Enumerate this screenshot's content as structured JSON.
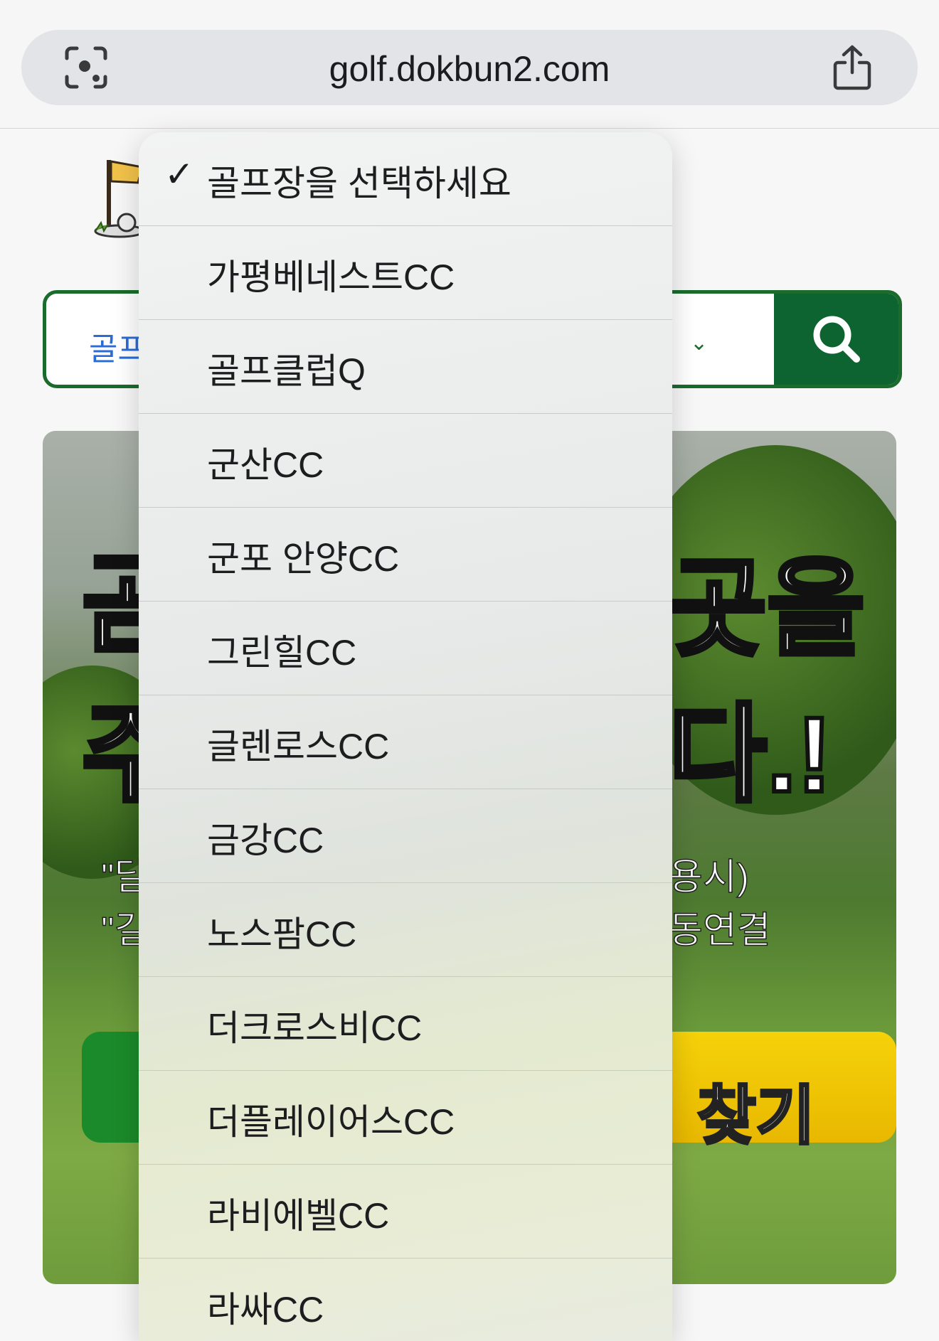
{
  "browser": {
    "url": "golf.dokbun2.com",
    "left_icon": "visual-lookup-icon",
    "right_icon": "share-icon"
  },
  "search": {
    "selected_partial": "골프",
    "chevron_icon": "chevron-down-icon",
    "button_icon": "search-icon"
  },
  "banner": {
    "text_fragments": [
      "곳을",
      "다.!",
      "용시)",
      "동연결",
      "찾기"
    ],
    "quote_marks": [
      "\"달",
      "\"길"
    ]
  },
  "dropdown": {
    "selected_index": 0,
    "options": [
      "골프장을 선택하세요",
      "가평베네스트CC",
      "골프클럽Q",
      "군산CC",
      "군포 안양CC",
      "그린힐CC",
      "글렌로스CC",
      "금강CC",
      "노스팜CC",
      "더크로스비CC",
      "더플레이어스CC",
      "라비에벨CC",
      "라싸CC"
    ],
    "check_glyph": "✓"
  },
  "colors": {
    "brand_green": "#0e6430",
    "select_text_blue": "#2a6cd6",
    "cta_yellow": "#f6d20a",
    "cta_green": "#1b8a2a"
  }
}
